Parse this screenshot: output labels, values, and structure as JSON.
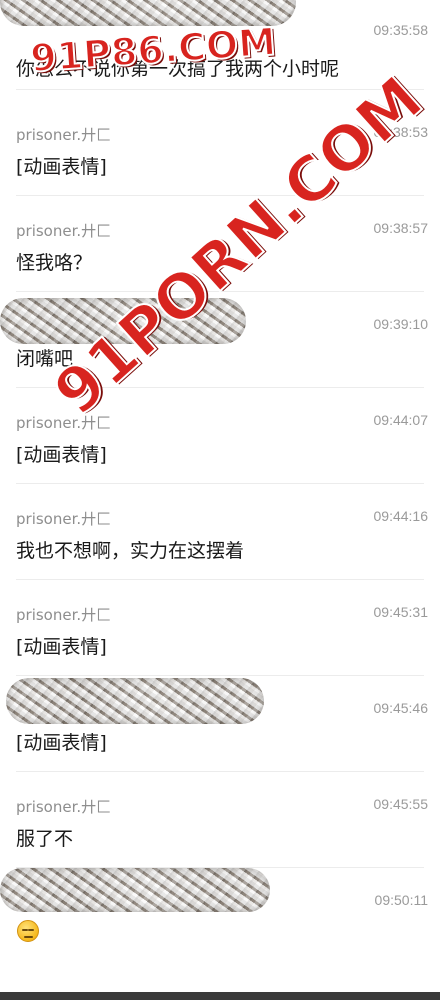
{
  "records": [
    {
      "sender": "",
      "redacted": true,
      "time": "09:35:58",
      "message": "你怎么不说你第一次搞了我两个小时呢"
    },
    {
      "sender": "prisoner.廾匚",
      "redacted": false,
      "time": "09:38:53",
      "message": "[动画表情]"
    },
    {
      "sender": "prisoner.廾匚",
      "redacted": false,
      "time": "09:38:57",
      "message": "怪我咯？"
    },
    {
      "sender": "",
      "redacted": true,
      "time": "09:39:10",
      "message": "闭嘴吧"
    },
    {
      "sender": "prisoner.廾匚",
      "redacted": false,
      "time": "09:44:07",
      "message": "[动画表情]"
    },
    {
      "sender": "prisoner.廾匚",
      "redacted": false,
      "time": "09:44:16",
      "message": "我也不想啊，实力在这摆着"
    },
    {
      "sender": "prisoner.廾匚",
      "redacted": false,
      "time": "09:45:31",
      "message": "[动画表情]"
    },
    {
      "sender": "",
      "redacted": true,
      "time": "09:45:46",
      "message": "[动画表情]"
    },
    {
      "sender": "prisoner.廾匚",
      "redacted": false,
      "time": "09:45:55",
      "message": "服了不"
    },
    {
      "sender": "",
      "redacted": true,
      "time": "09:50:11",
      "message": "",
      "emoji": "unamused-face-icon"
    }
  ],
  "watermark": {
    "top": "91P86.COM",
    "diagonal": "91PORN.COM"
  }
}
